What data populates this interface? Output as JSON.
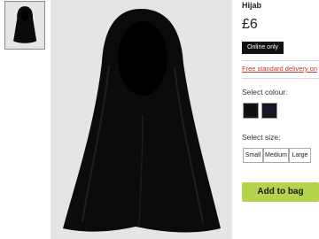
{
  "product": {
    "title": "Hijab",
    "price": "£6",
    "badge": "Online only",
    "delivery_link": "Free standard delivery on"
  },
  "colour": {
    "label": "Select colour:",
    "options": [
      "black",
      "navy"
    ]
  },
  "size": {
    "label": "Select size:",
    "options": [
      "Small",
      "Medium",
      "Large"
    ]
  },
  "actions": {
    "add_to_bag": "Add to bag"
  },
  "colors": {
    "accent": "#b5d44b",
    "delivery_link": "#c0392b",
    "badge_bg": "#111111"
  }
}
